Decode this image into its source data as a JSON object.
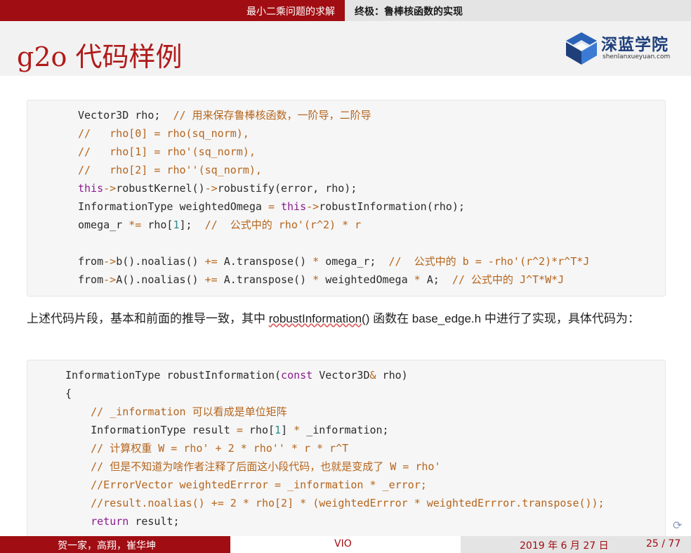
{
  "header": {
    "section": "最小二乘问题的求解",
    "subsection": "终极：鲁棒核函数的实现"
  },
  "slide": {
    "title": "g2o 代码样例"
  },
  "logo": {
    "name": "深蓝学院",
    "domain": "shenlanxueyuan.com"
  },
  "code1": [
    "Vector3D rho;  // 用来保存鲁棒核函数，一阶导，二阶导",
    "//   rho[0] = rho(sq_norm),",
    "//   rho[1] = rho'(sq_norm),",
    "//   rho[2] = rho''(sq_norm),",
    "this->robustKernel()->robustify(error, rho);",
    "InformationType weightedOmega = this->robustInformation(rho);",
    "omega_r *= rho[1];  //  公式中的 rho'(r^2) * r",
    "",
    "from->b().noalias() += A.transpose() * omega_r;  //  公式中的 b = -rho'(r^2)*r^T*J",
    "from->A().noalias() += A.transpose() * weightedOmega * A;  // 公式中的 J^T*W*J"
  ],
  "paragraph": {
    "before": "上述代码片段，基本和前面的推导一致，其中 ",
    "highlight": "robustInformation",
    "after": "() 函数在 base_edge.h 中进行了实现，具体代码为："
  },
  "code2": [
    "InformationType robustInformation(const Vector3D& rho)",
    "{",
    "    // _information 可以看成是单位矩阵",
    "    InformationType result = rho[1] * _information;",
    "    // 计算权重 W = rho' + 2 * rho'' * r * r^T",
    "    // 但是不知道为啥作者注释了后面这小段代码，也就是变成了 W = rho'",
    "    //ErrorVector weightedErrror = _information * _error;",
    "    //result.noalias() += 2 * rho[2] * (weightedErrror * weightedErrror.transpose());",
    "    return result;"
  ],
  "footer": {
    "authors": "贺一家，高翔，崔华坤",
    "short_title": "VIO",
    "date": "2019 年 6 月 27 日",
    "page": "25 / 77"
  },
  "colors": {
    "accent": "#a00d12",
    "title": "#b01a1a",
    "keyword": "#8b1b8f",
    "function": "#2d5fd1",
    "comment": "#b5651d"
  }
}
